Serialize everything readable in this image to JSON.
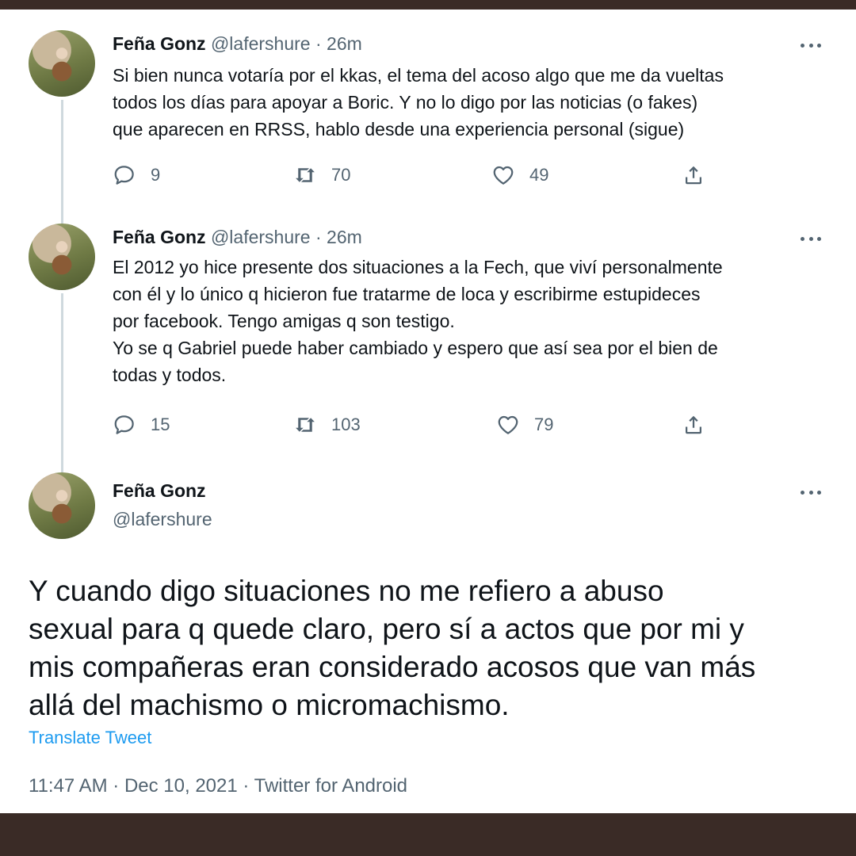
{
  "tweets": [
    {
      "name": "Feña Gonz",
      "handle": "@lafershure",
      "separator": "·",
      "time": "26m",
      "text": "Si bien nunca votaría por el kkas, el tema del acoso algo que me da vueltas\ntodos los días para apoyar a Boric. Y no lo digo por las noticias (o fakes)\nque aparecen en RRSS, hablo desde una experiencia personal (sigue)",
      "replies": "9",
      "retweets": "70",
      "likes": "49"
    },
    {
      "name": "Feña Gonz",
      "handle": "@lafershure",
      "separator": "·",
      "time": "26m",
      "text": "El 2012 yo hice presente dos situaciones a la Fech, que viví personalmente\ncon él y lo único q hicieron fue tratarme de loca y escribirme estupideces\npor facebook. Tengo amigas q son testigo.\nYo se q Gabriel puede haber cambiado y espero que así sea por el bien de\ntodas y todos.",
      "replies": "15",
      "retweets": "103",
      "likes": "79"
    }
  ],
  "main_tweet": {
    "name": "Feña Gonz",
    "handle": "@lafershure",
    "text": "Y cuando digo situaciones no me refiero a abuso\nsexual para q quede claro, pero sí a actos que por mi y\nmis compañeras eran considerado acosos que van más\nallá del machismo o micromachismo.",
    "translate_label": "Translate Tweet",
    "timestamp": "11:47 AM · Dec 10, 2021 · Twitter for Android"
  },
  "colors": {
    "accent": "#1d9bf0",
    "secondary_text": "#536471",
    "frame": "#3a2b26"
  },
  "icons": [
    "reply-icon",
    "retweet-icon",
    "like-icon",
    "share-icon",
    "more-icon"
  ]
}
